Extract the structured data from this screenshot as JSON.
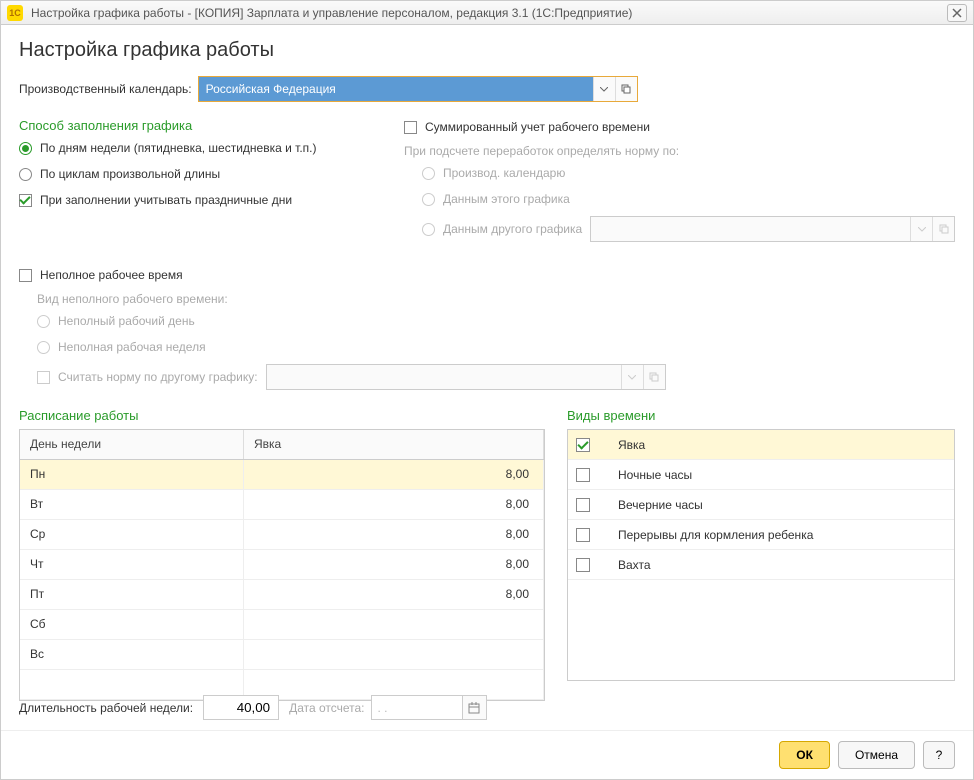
{
  "titlebar": {
    "icon_text": "1С",
    "title": "Настройка графика работы - [КОПИЯ] Зарплата и управление персоналом, редакция 3.1  (1С:Предприятие)"
  },
  "page_title": "Настройка графика работы",
  "calendar": {
    "label": "Производственный календарь:",
    "value": "Российская Федерация"
  },
  "fill_method": {
    "title": "Способ заполнения графика",
    "opt_by_week": "По дням недели (пятидневка, шестидневка и т.п.)",
    "opt_by_cycles": "По циклам произвольной длины",
    "opt_holidays": "При заполнении учитывать праздничные дни"
  },
  "sum_section": {
    "sum_time": "Суммированный учет рабочего времени",
    "overtime_label": "При подсчете переработок определять норму по:",
    "opt_prod_cal": "Производ. календарю",
    "opt_this_sched": "Данным этого графика",
    "opt_other_sched": "Данным другого графика"
  },
  "partial": {
    "label": "Неполное рабочее время",
    "subtitle": "Вид неполного рабочего времени:",
    "opt_day": "Неполный рабочий день",
    "opt_week": "Неполная рабочая неделя",
    "opt_norm": "Считать норму по другому графику:"
  },
  "schedule": {
    "title": "Расписание работы",
    "col_day": "День недели",
    "col_val": "Явка",
    "rows": [
      {
        "day": "Пн",
        "val": "8,00"
      },
      {
        "day": "Вт",
        "val": "8,00"
      },
      {
        "day": "Ср",
        "val": "8,00"
      },
      {
        "day": "Чт",
        "val": "8,00"
      },
      {
        "day": "Пт",
        "val": "8,00"
      },
      {
        "day": "Сб",
        "val": ""
      },
      {
        "day": "Вс",
        "val": ""
      }
    ]
  },
  "time_types": {
    "title": "Виды времени",
    "rows": [
      {
        "label": "Явка",
        "checked": true
      },
      {
        "label": "Ночные часы",
        "checked": false
      },
      {
        "label": "Вечерние часы",
        "checked": false
      },
      {
        "label": "Перерывы для кормления ребенка",
        "checked": false
      },
      {
        "label": "Вахта",
        "checked": false
      }
    ]
  },
  "bottom": {
    "duration_label": "Длительность рабочей недели:",
    "duration_value": "40,00",
    "date_label": "Дата отсчета:",
    "date_value": " .  .   "
  },
  "footer": {
    "ok": "ОК",
    "cancel": "Отмена",
    "help": "?"
  }
}
